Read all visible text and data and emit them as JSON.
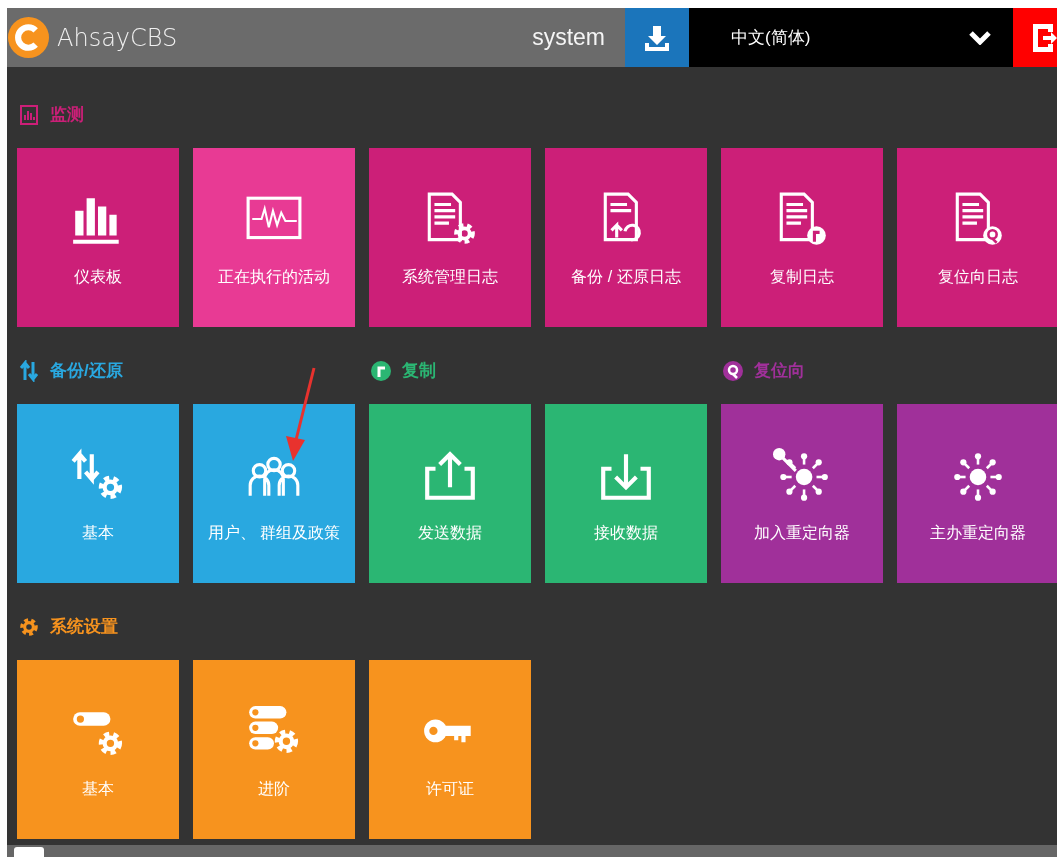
{
  "header": {
    "title": "AhsayCBS",
    "user": "system",
    "language": "中文(简体)"
  },
  "rows": [
    {
      "sections": [
        {
          "title": "监测",
          "color": "#cc1f78",
          "tiles": [
            {
              "label": "仪表板",
              "selected": false
            },
            {
              "label": "正在执行的活动",
              "selected": true
            },
            {
              "label": "系统管理日志",
              "selected": false
            },
            {
              "label": "备份 / 还原日志",
              "selected": false
            },
            {
              "label": "复制日志",
              "selected": false
            },
            {
              "label": "复位向日志",
              "selected": false
            }
          ]
        }
      ]
    },
    {
      "sections": [
        {
          "title": "备份/还原",
          "color": "#29a8e0",
          "tiles": [
            {
              "label": "基本",
              "selected": false
            },
            {
              "label": "用户、 群组及政策",
              "selected": false
            }
          ]
        },
        {
          "title": "复制",
          "color": "#2bb673",
          "tiles": [
            {
              "label": "发送数据",
              "selected": false
            },
            {
              "label": "接收数据",
              "selected": false
            }
          ]
        },
        {
          "title": "复位向",
          "color": "#a0309a",
          "tiles": [
            {
              "label": "加入重定向器",
              "selected": false
            },
            {
              "label": "主办重定向器",
              "selected": false
            }
          ]
        }
      ]
    },
    {
      "sections": [
        {
          "title": "系统设置",
          "color": "#f7931e",
          "tiles": [
            {
              "label": "基本",
              "selected": false
            },
            {
              "label": "进阶",
              "selected": false
            },
            {
              "label": "许可证",
              "selected": false
            }
          ]
        }
      ]
    }
  ]
}
